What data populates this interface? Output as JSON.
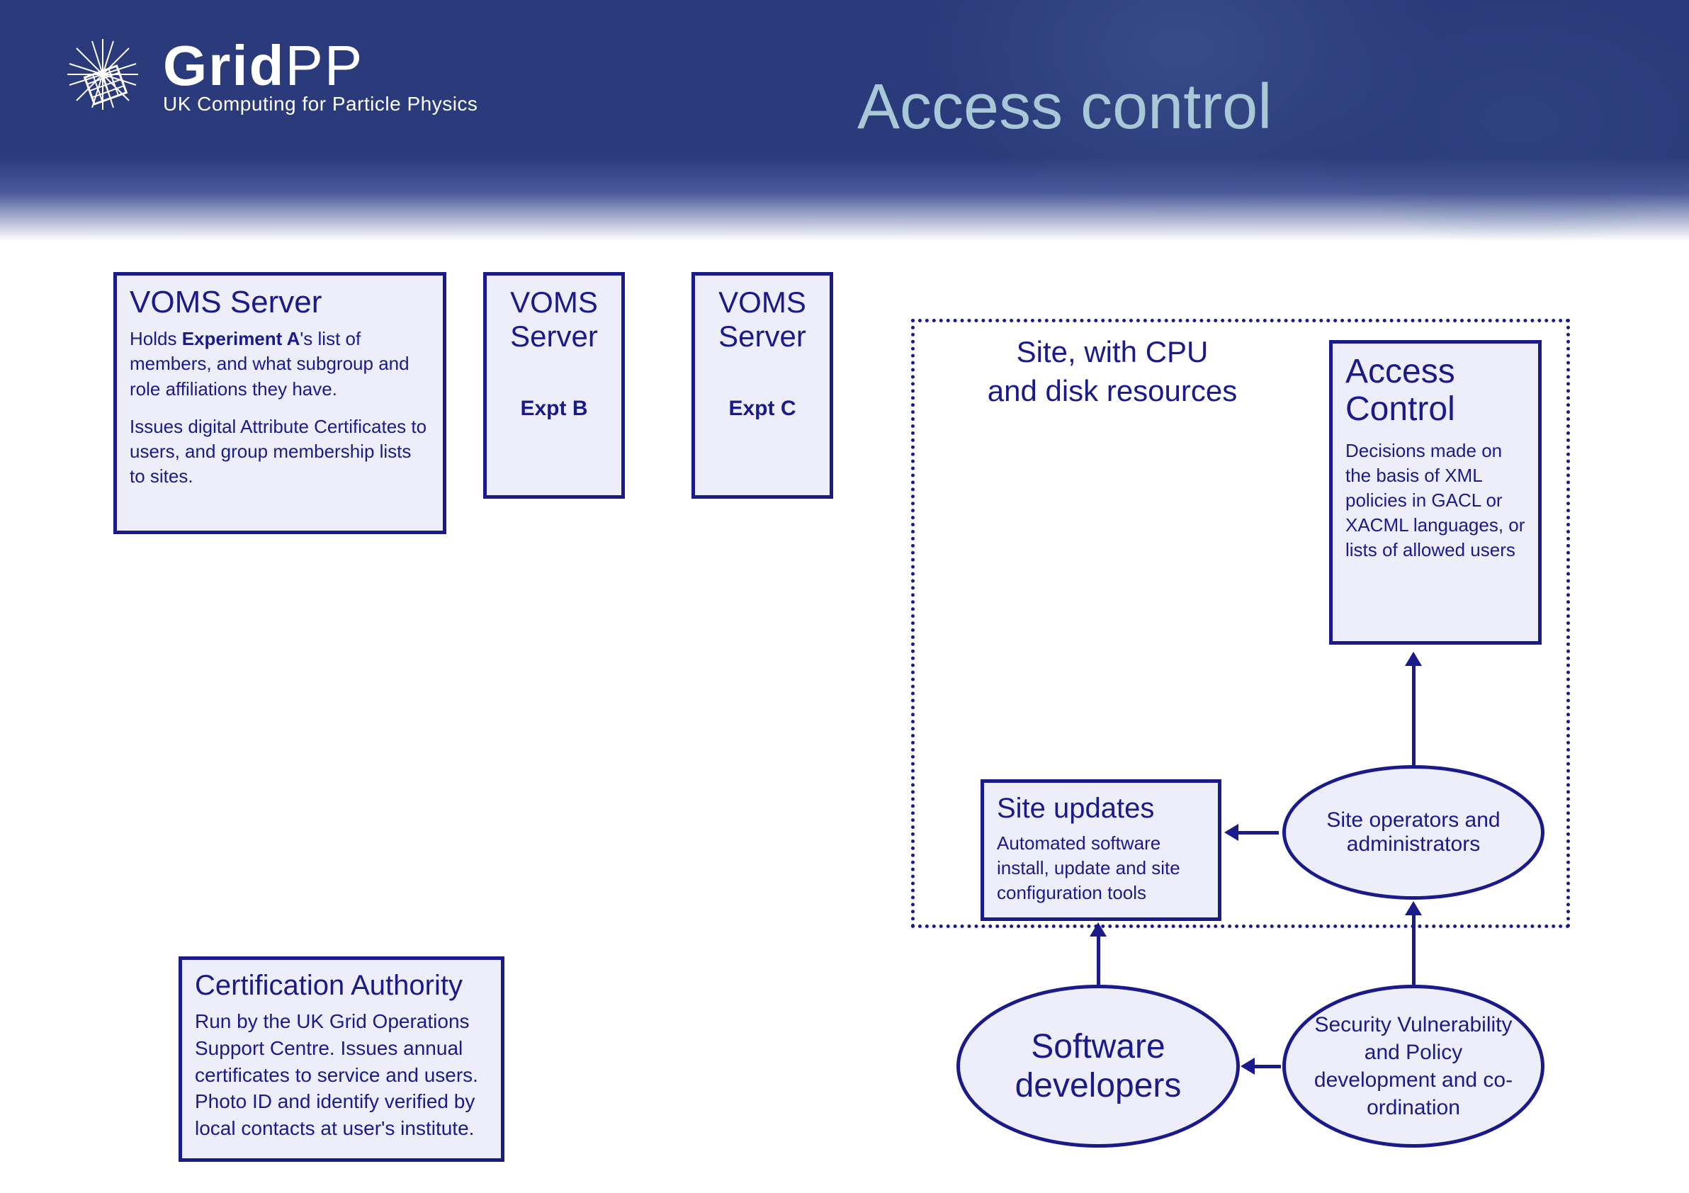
{
  "header": {
    "logo_main_bold": "Grid",
    "logo_main_light": "PP",
    "logo_subtitle": "UK Computing for Particle Physics",
    "page_title": "Access control"
  },
  "voms_a": {
    "title": "VOMS Server",
    "body_line1": "Holds ",
    "body_bold": "Experiment A",
    "body_line1_rest": "'s list of members, and what subgroup and role affiliations they have.",
    "body_para2": "Issues digital Attribute Certificates to users, and group membership lists to sites."
  },
  "voms_b": {
    "title": "VOMS Server",
    "sub": "Expt B"
  },
  "voms_c": {
    "title": "VOMS Server",
    "sub": "Expt C"
  },
  "site_label": "Site, with CPU\nand disk resources",
  "access_control": {
    "title": "Access Control",
    "body": "Decisions made on the basis of XML policies in GACL or XACML languages, or lists of allowed users"
  },
  "site_updates": {
    "title": "Site updates",
    "body": "Automated software install, update and site configuration tools"
  },
  "ellipses": {
    "ops": "Site operators and administrators",
    "dev": "Software developers",
    "sec": "Security Vulnerability and Policy development and co-ordination"
  },
  "ca": {
    "title": "Certification Authority",
    "body": "Run by the UK Grid Operations Support Centre. Issues annual certificates to service and users. Photo ID and identify verified by local contacts at user's institute."
  }
}
